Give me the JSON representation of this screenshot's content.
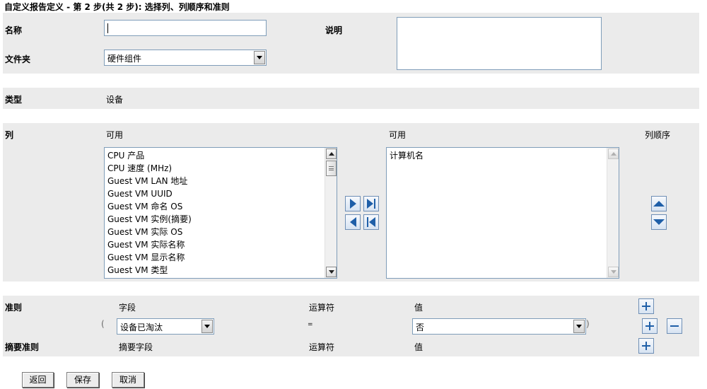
{
  "page_title": "自定义报告定义 - 第 2 步(共 2 步): 选择列、列顺序和准则",
  "name_field": {
    "label": "名称",
    "value": ""
  },
  "description": {
    "label": "说明",
    "value": ""
  },
  "folder": {
    "label": "文件夹",
    "selected": "硬件组件"
  },
  "type": {
    "label": "类型",
    "value": "设备"
  },
  "columns": {
    "label": "列",
    "available_header": "可用",
    "selected_header": "可用",
    "order_header": "列顺序",
    "available_items": [
      "CPU 产品",
      "CPU 速度 (MHz)",
      "Guest VM LAN 地址",
      "Guest VM UUID",
      "Guest VM 命名 OS",
      "Guest VM 实例(摘要)",
      "Guest VM 实际 OS",
      "Guest VM 实际名称",
      "Guest VM 显示名称",
      "Guest VM 类型"
    ],
    "selected_items": [
      "计算机名"
    ]
  },
  "criteria": {
    "label": "准则",
    "field_header": "字段",
    "operator_header": "运算符",
    "value_header": "值",
    "open_paren": "(",
    "close_paren": ")",
    "row": {
      "field": "设备已淘汰",
      "operator": "=",
      "value": "否"
    }
  },
  "summary_criteria": {
    "label": "摘要准则",
    "field_header": "摘要字段",
    "operator_header": "运算符",
    "value_header": "值"
  },
  "buttons": {
    "back": "返回",
    "save": "保存",
    "cancel": "取消"
  },
  "colors": {
    "band": "#ebebeb",
    "accent": "#1f5fa8",
    "border": "#7f9db9"
  }
}
